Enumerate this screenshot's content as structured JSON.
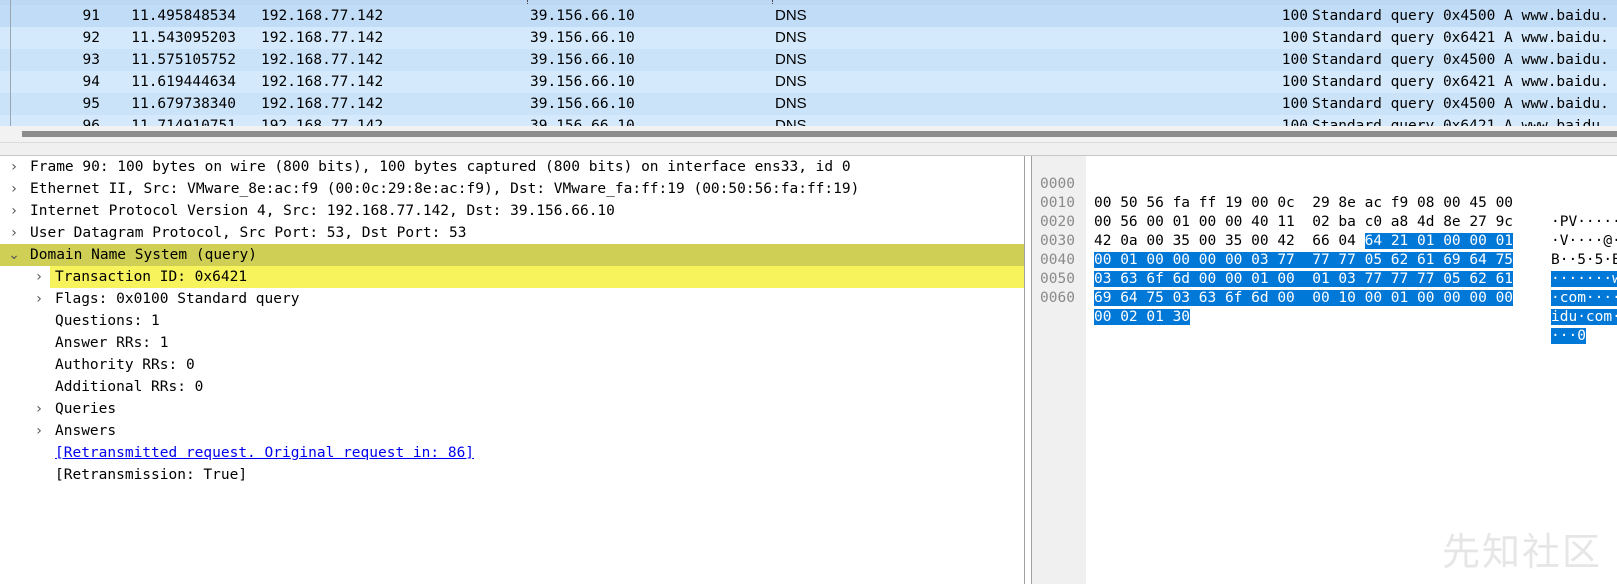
{
  "packet_list": {
    "rows": [
      {
        "no": "91",
        "time": "11.495848534",
        "src": "192.168.77.142",
        "dst": "39.156.66.10",
        "proto": "DNS",
        "len": "100",
        "info": "Standard query 0x4500 A www.baidu."
      },
      {
        "no": "92",
        "time": "11.543095203",
        "src": "192.168.77.142",
        "dst": "39.156.66.10",
        "proto": "DNS",
        "len": "100",
        "info": "Standard query 0x6421 A www.baidu."
      },
      {
        "no": "93",
        "time": "11.575105752",
        "src": "192.168.77.142",
        "dst": "39.156.66.10",
        "proto": "DNS",
        "len": "100",
        "info": "Standard query 0x4500 A www.baidu."
      },
      {
        "no": "94",
        "time": "11.619444634",
        "src": "192.168.77.142",
        "dst": "39.156.66.10",
        "proto": "DNS",
        "len": "100",
        "info": "Standard query 0x6421 A www.baidu."
      },
      {
        "no": "95",
        "time": "11.679738340",
        "src": "192.168.77.142",
        "dst": "39.156.66.10",
        "proto": "DNS",
        "len": "100",
        "info": "Standard query 0x4500 A www.baidu."
      },
      {
        "no": "96",
        "time": "11.714910751",
        "src": "192.168.77.142",
        "dst": "39.156.66.10",
        "proto": "DNS",
        "len": "100",
        "info": "Standard query 0x6421 A www.baidu."
      }
    ]
  },
  "details": {
    "frame": "Frame 90: 100 bytes on wire (800 bits), 100 bytes captured (800 bits) on interface ens33, id 0",
    "ethernet": "Ethernet II, Src: VMware_8e:ac:f9 (00:0c:29:8e:ac:f9), Dst: VMware_fa:ff:19 (00:50:56:fa:ff:19)",
    "ip": "Internet Protocol Version 4, Src: 192.168.77.142, Dst: 39.156.66.10",
    "udp": "User Datagram Protocol, Src Port: 53, Dst Port: 53",
    "dns": "Domain Name System (query)",
    "transaction_id": "Transaction ID: 0x6421",
    "flags": "Flags: 0x0100 Standard query",
    "questions": "Questions: 1",
    "answer_rrs": "Answer RRs: 1",
    "authority_rrs": "Authority RRs: 0",
    "additional_rrs": "Additional RRs: 0",
    "queries": "Queries",
    "answers": "Answers",
    "retransmitted_link": "[Retransmitted request. Original request in: 86]",
    "retransmission": "[Retransmission: True]"
  },
  "hex": {
    "rows": [
      {
        "off": "0000",
        "pre": "00 50 56 fa ff 19 00 0c  29 8e ac f9 08 00 45 00",
        "sel": "",
        "post": "",
        "apre": "·PV·····",
        "asel": "",
        "apost": ""
      },
      {
        "off": "0010",
        "pre": "00 56 00 01 00 00 40 11  02 ba c0 a8 4d 8e 27 9c",
        "sel": "",
        "post": "",
        "apre": "·V····@·",
        "asel": "",
        "apost": ""
      },
      {
        "off": "0020",
        "pre": "42 0a 00 35 00 35 00 42  66 04 ",
        "sel": "64 21 01 00 00 01",
        "post": "",
        "apre": "B··5·5·B",
        "asel": "",
        "apost": ""
      },
      {
        "off": "0030",
        "pre": "",
        "sel": "00 01 00 00 00 00 03 77  77 77 05 62 61 69 64 75",
        "post": "",
        "apre": "",
        "asel": "·······w",
        "apost": ""
      },
      {
        "off": "0040",
        "pre": "",
        "sel": "03 63 6f 6d 00 00 01 00  01 03 77 77 77 05 62 61",
        "post": "",
        "apre": "",
        "asel": "·com····",
        "apost": ""
      },
      {
        "off": "0050",
        "pre": "",
        "sel": "69 64 75 03 63 6f 6d 00  00 10 00 01 00 00 00 00",
        "post": "",
        "apre": "",
        "asel": "idu·com·",
        "apost": ""
      },
      {
        "off": "0060",
        "pre": "",
        "sel": "00 02 01 30",
        "post": "",
        "apre": "",
        "asel": "···0",
        "apost": ""
      }
    ]
  },
  "watermark": "先知社区"
}
